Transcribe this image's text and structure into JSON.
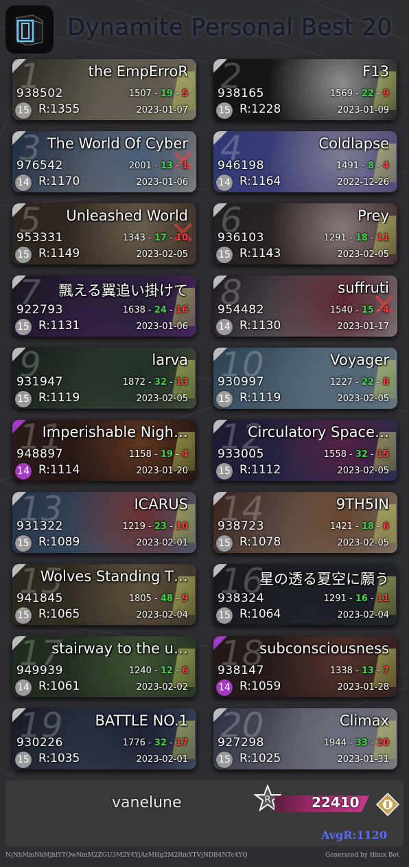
{
  "header": {
    "title": "Dynamite Personal Best 20"
  },
  "cards": [
    {
      "rank": "1",
      "song": "the EmpErroR",
      "score": "938502",
      "j1": "1507",
      "j2": "19",
      "j3": "5",
      "level": "15",
      "rating": "R:1355",
      "date": "2023-01-07",
      "diff": "gray",
      "art": [
        "#3a3630",
        "#8a8270",
        "#c9c0a0"
      ],
      "mark": "medal"
    },
    {
      "rank": "2",
      "song": "F13",
      "score": "938165",
      "j1": "1569",
      "j2": "22",
      "j3": "9",
      "level": "15",
      "rating": "R:1228",
      "date": "2023-01-09",
      "diff": "gray",
      "art": [
        "#1b1b1b",
        "#cfcfcf",
        "#2a2a2a"
      ],
      "mark": "medal"
    },
    {
      "rank": "3",
      "song": "The World Of Cyber",
      "score": "976542",
      "j1": "2001",
      "j2": "13",
      "j3": "1",
      "level": "14",
      "rating": "R:1170",
      "date": "2023-01-06",
      "diff": "gray",
      "art": [
        "#243a5a",
        "#6a8ab0",
        "#d0c8c0"
      ],
      "mark": "x"
    },
    {
      "rank": "4",
      "song": "Coldlapse",
      "score": "946198",
      "j1": "1491",
      "j2": "8",
      "j3": "4",
      "level": "14",
      "rating": "R:1164",
      "date": "2022-12-26",
      "diff": "gray",
      "art": [
        "#3a4a9a",
        "#b8b8d8",
        "#7a68b8"
      ],
      "mark": "medal"
    },
    {
      "rank": "5",
      "song": "Unleashed World",
      "score": "953331",
      "j1": "1343",
      "j2": "17",
      "j3": "10",
      "level": "15",
      "rating": "R:1149",
      "date": "2023-02-05",
      "diff": "gray",
      "art": [
        "#3a3028",
        "#9a8a70",
        "#5a4838"
      ],
      "mark": "x"
    },
    {
      "rank": "6",
      "song": "Prey",
      "score": "936103",
      "j1": "1291",
      "j2": "18",
      "j3": "11",
      "level": "15",
      "rating": "R:1143",
      "date": "2023-02-05",
      "diff": "gray",
      "art": [
        "#2a2a2a",
        "#c8b0b0",
        "#5a3a3a"
      ],
      "mark": "medal"
    },
    {
      "rank": "7",
      "song": "飄える翼追い掛けて",
      "score": "922793",
      "j1": "1638",
      "j2": "24",
      "j3": "16",
      "level": "15",
      "rating": "R:1131",
      "date": "2023-01-06",
      "diff": "gray",
      "art": [
        "#1e1e28",
        "#3a3050",
        "#7a3aa0"
      ],
      "mark": "medal"
    },
    {
      "rank": "8",
      "song": "suffruti",
      "score": "954482",
      "j1": "1540",
      "j2": "15",
      "j3": "4",
      "level": "14",
      "rating": "R:1130",
      "date": "2023-01-17",
      "diff": "gray",
      "art": [
        "#2a2028",
        "#8a3848",
        "#c8c0c8"
      ],
      "mark": "x"
    },
    {
      "rank": "9",
      "song": "larva",
      "score": "931947",
      "j1": "1872",
      "j2": "32",
      "j3": "13",
      "level": "15",
      "rating": "R:1119",
      "date": "2023-02-05",
      "diff": "gray",
      "art": [
        "#1a2420",
        "#304838",
        "#6a7a60"
      ],
      "mark": "medal"
    },
    {
      "rank": "10",
      "song": "Voyager",
      "score": "930997",
      "j1": "1227",
      "j2": "22",
      "j3": "8",
      "level": "15",
      "rating": "R:1119",
      "date": "2023-02-05",
      "diff": "gray",
      "art": [
        "#3a5870",
        "#7a98b0",
        "#a0b8c8"
      ],
      "mark": "medal"
    },
    {
      "rank": "11",
      "song": "Imperishable Nigh…",
      "score": "948897",
      "j1": "1158",
      "j2": "19",
      "j3": "4",
      "level": "14",
      "rating": "R:1114",
      "date": "2023-01-20",
      "diff": "purple",
      "art": [
        "#3a2420",
        "#8a5030",
        "#2a1a18"
      ],
      "mark": "medal"
    },
    {
      "rank": "12",
      "song": "Circulatory Space…",
      "score": "933005",
      "j1": "1558",
      "j2": "32",
      "j3": "15",
      "level": "15",
      "rating": "R:1112",
      "date": "2023-02-05",
      "diff": "gray",
      "art": [
        "#2a2040",
        "#7a3060",
        "#3a4a80"
      ],
      "mark": "medal"
    },
    {
      "rank": "13",
      "song": "ICARUS",
      "score": "931322",
      "j1": "1219",
      "j2": "23",
      "j3": "10",
      "level": "15",
      "rating": "R:1089",
      "date": "2023-02-01",
      "diff": "gray",
      "art": [
        "#30405a",
        "#a04848",
        "#7090b0"
      ],
      "mark": "medal"
    },
    {
      "rank": "14",
      "song": "9TH5IN",
      "score": "938723",
      "j1": "1421",
      "j2": "18",
      "j3": "6",
      "level": "15",
      "rating": "R:1078",
      "date": "2023-02-05",
      "diff": "gray",
      "art": [
        "#4a3028",
        "#9a6848",
        "#c8b8a8"
      ],
      "mark": "medal"
    },
    {
      "rank": "15",
      "song": "Wolves Standing T…",
      "score": "941845",
      "j1": "1805",
      "j2": "48",
      "j3": "9",
      "level": "15",
      "rating": "R:1065",
      "date": "2023-02-04",
      "diff": "gray",
      "art": [
        "#3a3428",
        "#8a7858",
        "#5a5040"
      ],
      "mark": "medal"
    },
    {
      "rank": "16",
      "song": "星の透る夏空に願う",
      "score": "938324",
      "j1": "1291",
      "j2": "16",
      "j3": "11",
      "level": "15",
      "rating": "R:1064",
      "date": "2023-02-04",
      "diff": "gray",
      "art": [
        "#1e2028",
        "#2a2c38",
        "#3a3c48"
      ],
      "mark": "medal"
    },
    {
      "rank": "17",
      "song": "stairway to the u…",
      "score": "949939",
      "j1": "1240",
      "j2": "12",
      "j3": "6",
      "level": "14",
      "rating": "R:1061",
      "date": "2023-02-02",
      "diff": "gray",
      "art": [
        "#2a3a28",
        "#5a7a48",
        "#3a4a38"
      ],
      "mark": "medal"
    },
    {
      "rank": "18",
      "song": "subconsciousness",
      "score": "938147",
      "j1": "1338",
      "j2": "13",
      "j3": "7",
      "level": "14",
      "rating": "R:1059",
      "date": "2023-01-28",
      "diff": "purple",
      "art": [
        "#2a2020",
        "#7a4a40",
        "#4a3030"
      ],
      "mark": "medal"
    },
    {
      "rank": "19",
      "song": "BATTLE NO.1",
      "score": "930226",
      "j1": "1776",
      "j2": "32",
      "j3": "17",
      "level": "15",
      "rating": "R:1035",
      "date": "2023-02-01",
      "diff": "gray",
      "art": [
        "#1e2230",
        "#2a3048",
        "#6a7aa0"
      ],
      "mark": "medal"
    },
    {
      "rank": "20",
      "song": "Climax",
      "score": "927298",
      "j1": "1944",
      "j2": "33",
      "j3": "20",
      "level": "15",
      "rating": "R:1025",
      "date": "2023-01-31",
      "diff": "gray",
      "art": [
        "#3a4058",
        "#9aa0b8",
        "#c8c0c8"
      ],
      "mark": "medal"
    }
  ],
  "footer": {
    "player": "vanelune",
    "total_rating": "22410",
    "avg": "AvgR:1120",
    "hash": "NjNhMmNkMjhlYTQwNmM2ZGU3M2Y4YjAzMHg2M2RmYTVjNDB4NTc4YQ",
    "generated_by": "Generated by Hinix Bot"
  },
  "colors": {
    "green": "#3fd24a",
    "red": "#ff3a3a",
    "purple": "#a43bc4",
    "gray": "#9a9a9a",
    "background": "#2e2e32"
  }
}
